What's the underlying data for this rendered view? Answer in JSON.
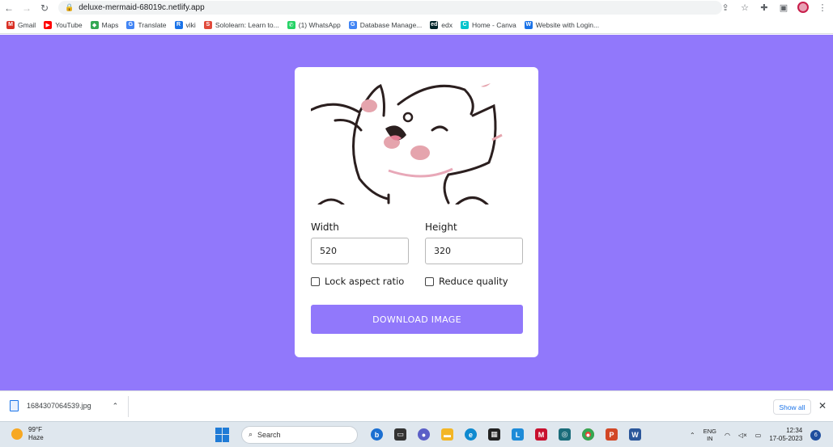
{
  "browser": {
    "url": "deluxe-mermaid-68019c.netlify.app",
    "bookmarks": [
      {
        "label": "Gmail",
        "color": "#d93025",
        "glyph": "M"
      },
      {
        "label": "YouTube",
        "color": "#ff0000",
        "glyph": "▶"
      },
      {
        "label": "Maps",
        "color": "#34a853",
        "glyph": "◆"
      },
      {
        "label": "Translate",
        "color": "#4285f4",
        "glyph": "G"
      },
      {
        "label": "viki",
        "color": "#1a73e8",
        "glyph": "R"
      },
      {
        "label": "Sololearn: Learn to...",
        "color": "#e14a3b",
        "glyph": "S"
      },
      {
        "label": "(1) WhatsApp",
        "color": "#25d366",
        "glyph": "✆"
      },
      {
        "label": "Database Manage...",
        "color": "#4285f4",
        "glyph": "G"
      },
      {
        "label": "edx",
        "color": "#02262b",
        "glyph": "ed"
      },
      {
        "label": "Home - Canva",
        "color": "#00c4cc",
        "glyph": "C"
      },
      {
        "label": "Website with Login...",
        "color": "#1a73e8",
        "glyph": "W"
      }
    ]
  },
  "form": {
    "width_label": "Width",
    "width_value": "520",
    "height_label": "Height",
    "height_value": "320",
    "lock_label": "Lock aspect ratio",
    "lock_checked": false,
    "reduce_label": "Reduce quality",
    "reduce_checked": false,
    "download_label": "DOWNLOAD IMAGE"
  },
  "colors": {
    "page_bg": "#9178fb",
    "button_bg": "#9178fb"
  },
  "downloads": {
    "filename": "1684307064539.jpg",
    "show_all": "Show all"
  },
  "taskbar": {
    "weather_temp": "99°F",
    "weather_desc": "Haze",
    "search_placeholder": "Search",
    "lang_top": "ENG",
    "lang_bottom": "IN",
    "time": "12:34",
    "date": "17-05-2023",
    "notif_count": "6"
  }
}
